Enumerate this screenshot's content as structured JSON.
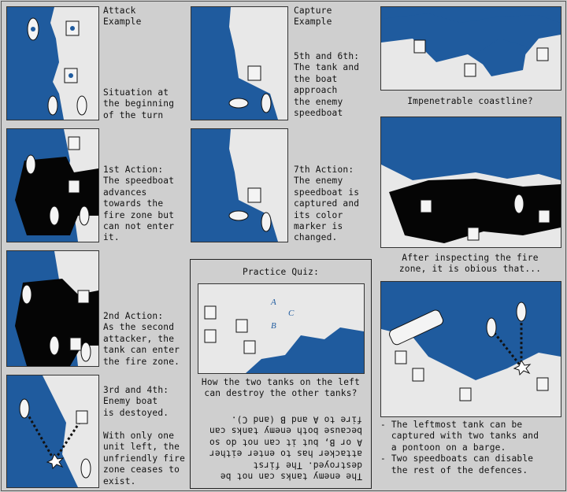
{
  "panels": {
    "attack_title": "Attack\nExample",
    "attack_situation": "Situation at\nthe beginning\nof the turn",
    "action1": "1st Action:\nThe speedboat\nadvances\ntowards the\nfire zone but\ncan not enter\nit.",
    "action2": "2nd Action:\nAs the second\nattacker, the\ntank can enter\nthe fire zone.",
    "action34": "3rd and 4th:\nEnemy boat\nis destoyed.",
    "action34_note": "With only one\nunit left, the\nunfriendly fire\nzone ceases to\nexist.",
    "capture_title": "Capture\nExample",
    "capture_56": "5th and 6th:\nThe tank and\nthe boat\napproach\nthe enemy\nspeedboat",
    "capture_7": "7th Action:\nThe enemy\nspeedboat is\ncaptured and\nits color\nmarker is\nchanged.",
    "coastline": "Impenetrable coastline?",
    "inspect": "After inspecting the fire\nzone, it is obious that...",
    "conclusions": "- The leftmost tank can be\n  captured with two tanks and\n  a pontoon on a barge.\n- Two speedboats can disable\n  the rest of the defences."
  },
  "quiz": {
    "title": "Practice Quiz:",
    "question": "How the two tanks on the left\ncan destroy the other tanks?",
    "answer": "The enemy tanks can not be\ndestroyed. The first\nattacker has to enter either\nA or B, but it can not do so\nbecause both enemy tanks can\nfire to A and B (and C).",
    "hex_labels": [
      "A",
      "B",
      "C"
    ]
  },
  "colors": {
    "water": "#1f5b9e",
    "land": "#e8e8e8",
    "fire_zone": "#050505"
  }
}
